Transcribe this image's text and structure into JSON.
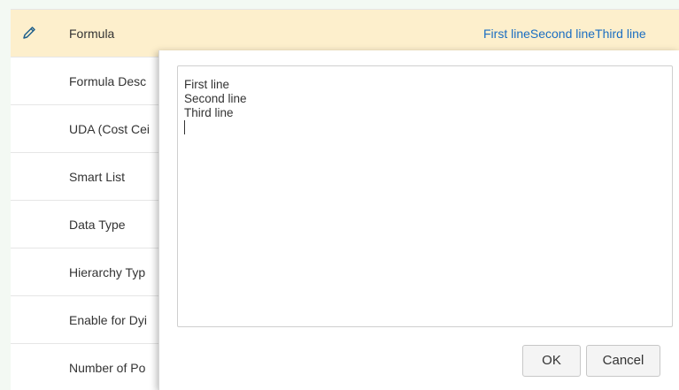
{
  "properties": {
    "rows": [
      {
        "label": "Formula",
        "value": "First lineSecond lineThird line"
      },
      {
        "label": "Formula Desc",
        "value": ""
      },
      {
        "label": "UDA (Cost Cei",
        "value": ""
      },
      {
        "label": "Smart List",
        "value": ""
      },
      {
        "label": "Data Type",
        "value": ""
      },
      {
        "label": "Hierarchy Typ",
        "value": ""
      },
      {
        "label": "Enable for Dyi",
        "value": ""
      },
      {
        "label": "Number of Po",
        "value": ""
      }
    ],
    "edit_icon": "pencil-icon"
  },
  "editor": {
    "lines": [
      "First line",
      "Second line",
      "Third line"
    ],
    "ok_label": "OK",
    "cancel_label": "Cancel"
  },
  "colors": {
    "active_row": "#fdefcc",
    "link_value": "#1b6ec2",
    "edit_icon": "#1f5f8b"
  }
}
